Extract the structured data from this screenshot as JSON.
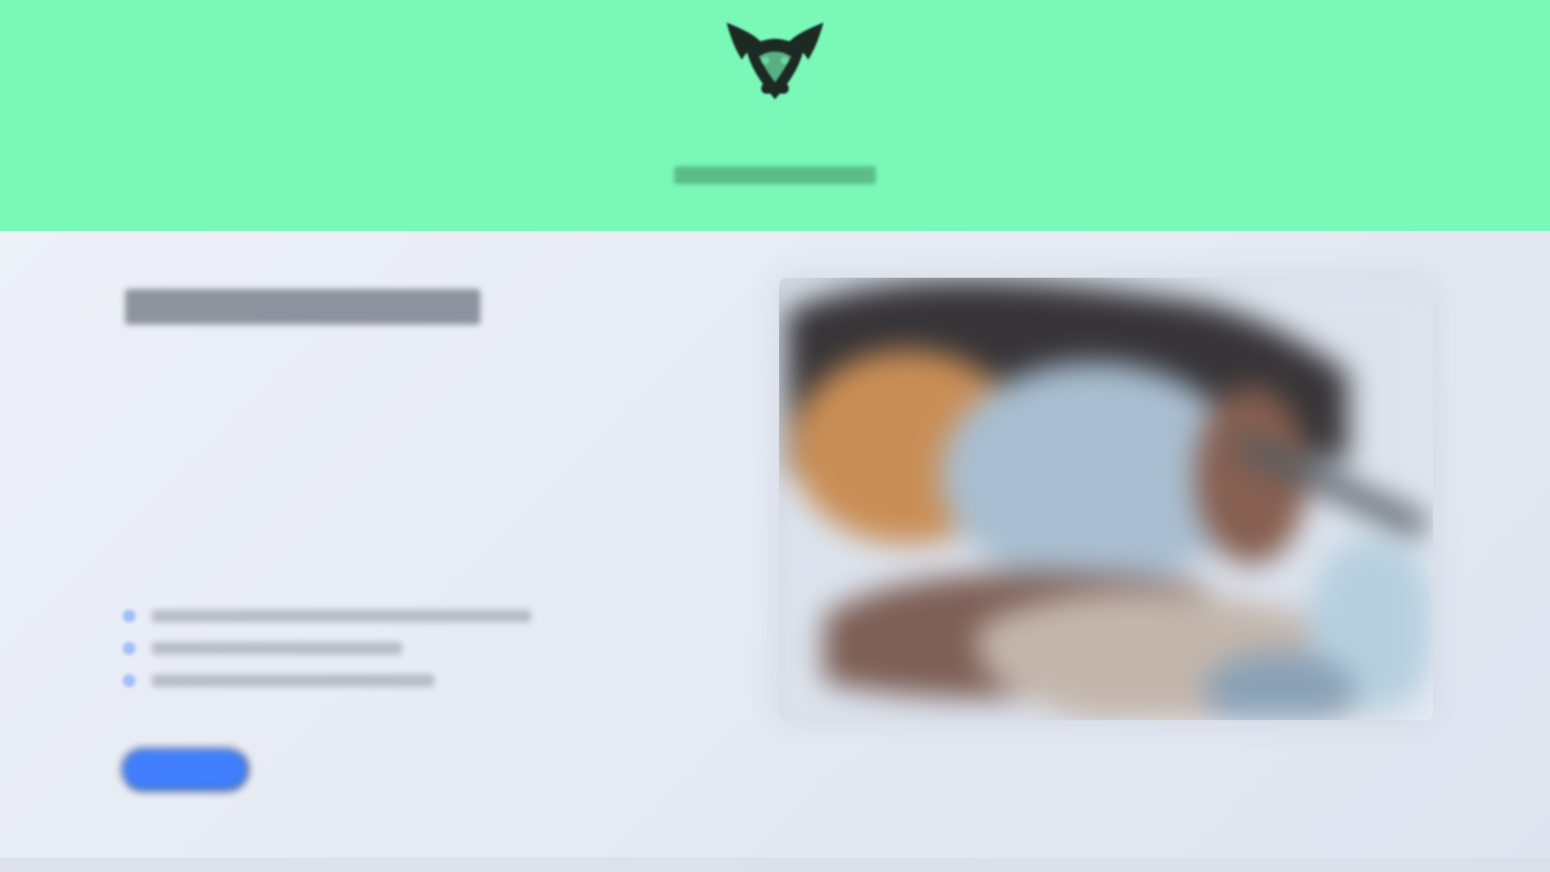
{
  "colors": {
    "header_background": "#79f8b8",
    "page_background": "#e8ecf4",
    "primary_button": "#2f74ff",
    "logo_green": "#2f8f5f"
  },
  "header": {
    "logo_icon": "bull-head-icon",
    "logo_text": "",
    "logo_subtext": ""
  },
  "main": {
    "heading": "",
    "paragraph": "",
    "bullets": [
      {
        "icon": "bullet-icon",
        "label": ""
      },
      {
        "icon": "bullet-icon",
        "label": ""
      },
      {
        "icon": "bullet-icon",
        "label": ""
      }
    ],
    "cta_label": "",
    "image_description": "blurred-photo"
  }
}
